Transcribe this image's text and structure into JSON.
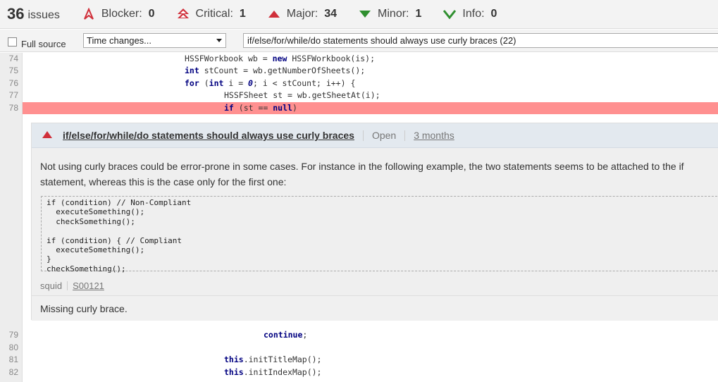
{
  "header": {
    "issues_count": "36",
    "issues_label": "issues",
    "severities": [
      {
        "label": "Blocker:",
        "count": "0",
        "icon": "blocker-icon"
      },
      {
        "label": "Critical:",
        "count": "1",
        "icon": "critical-icon"
      },
      {
        "label": "Major:",
        "count": "34",
        "icon": "major-icon"
      },
      {
        "label": "Minor:",
        "count": "1",
        "icon": "minor-icon"
      },
      {
        "label": "Info:",
        "count": "0",
        "icon": "info-icon"
      }
    ]
  },
  "filters": {
    "full_source_label": "Full source",
    "time_changes_value": "Time changes...",
    "rule_value": "if/else/for/while/do statements should always use curly braces (22)"
  },
  "code": {
    "lines": [
      {
        "num": "74",
        "text": "HSSFWorkbook wb = new HSSFWorkbook(is);"
      },
      {
        "num": "75",
        "text": "int stCount = wb.getNumberOfSheets();"
      },
      {
        "num": "76",
        "text": "for (int i = 0; i < stCount; i++) {"
      },
      {
        "num": "77",
        "text": "HSSFSheet st = wb.getSheetAt(i);"
      },
      {
        "num": "78",
        "text": "if (st == null)"
      },
      {
        "num": "79",
        "text": "continue;"
      },
      {
        "num": "80",
        "text": ""
      },
      {
        "num": "81",
        "text": "this.initTitleMap();"
      },
      {
        "num": "82",
        "text": "this.initIndexMap();"
      }
    ]
  },
  "issue": {
    "title": "if/else/for/while/do statements should always use curly braces",
    "status": "Open",
    "age": "3 months",
    "description": "Not using curly braces could be error-prone in some cases. For instance in the following example, the two statements seems to be attached to the if statement, whereas this is the case only for the first one:",
    "example": "if (condition) // Non-Compliant\n  executeSomething();\n  checkSomething();\n\nif (condition) { // Compliant\n  executeSomething();\n}\ncheckSomething();",
    "repo": "squid",
    "rule_key": "S00121",
    "message": "Missing curly brace."
  },
  "colors": {
    "highlight": "#ff9090",
    "major": "#d02f3a",
    "minor": "#2f8f2f"
  }
}
